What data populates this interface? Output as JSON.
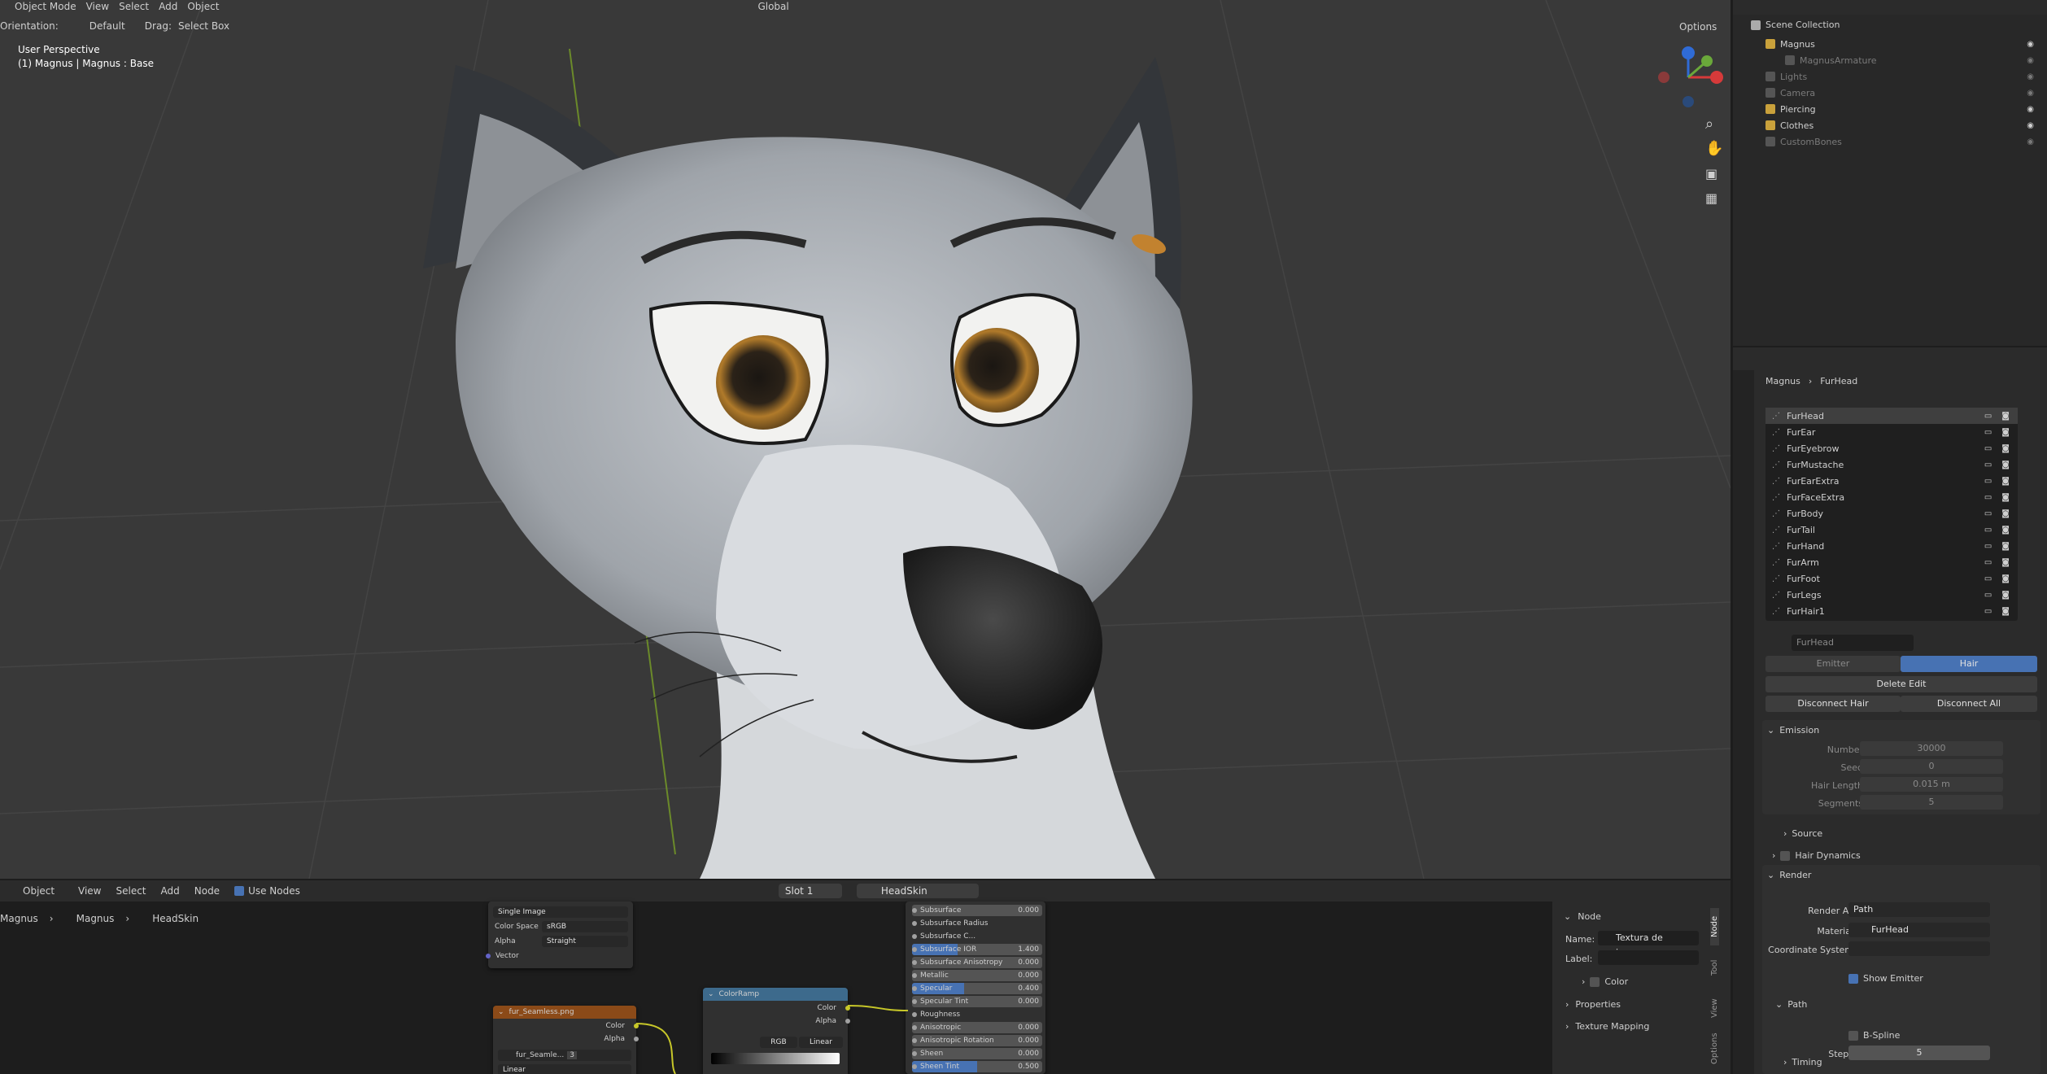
{
  "viewport": {
    "mode": "Object Mode",
    "menus": [
      "View",
      "Select",
      "Add",
      "Object"
    ],
    "orientation_label": "Orientation:",
    "orientation_value": "Default",
    "drag_label": "Drag:",
    "drag_value": "Select Box",
    "transform_space": "Global",
    "options": "Options",
    "overlay_line1": "User Perspective",
    "overlay_line2": "(1) Magnus | Magnus : Base"
  },
  "outliner": {
    "root": "Scene Collection",
    "items": [
      {
        "name": "Magnus",
        "dim": false
      },
      {
        "name": "MagnusArmature",
        "dim": true
      },
      {
        "name": "Lights",
        "dim": true
      },
      {
        "name": "Camera",
        "dim": true
      },
      {
        "name": "Piercing",
        "dim": false
      },
      {
        "name": "Clothes",
        "dim": false
      },
      {
        "name": "CustomBones",
        "dim": true
      }
    ]
  },
  "properties": {
    "breadcrumb_object": "Magnus",
    "breadcrumb_system": "FurHead",
    "systems": [
      "FurHead",
      "FurEar",
      "FurEyebrow",
      "FurMustache",
      "FurEarExtra",
      "FurFaceExtra",
      "FurBody",
      "FurTail",
      "FurHand",
      "FurArm",
      "FurFoot",
      "FurLegs",
      "FurHair1"
    ],
    "settings_name": "FurHead",
    "type_emitter": "Emitter",
    "type_hair": "Hair",
    "delete_edit": "Delete Edit",
    "disconnect_hair": "Disconnect Hair",
    "disconnect_all": "Disconnect All",
    "emission": {
      "title": "Emission",
      "number_label": "Number",
      "number": "30000",
      "seed_label": "Seed",
      "seed": "0",
      "hair_length_label": "Hair Length",
      "hair_length": "0.015 m",
      "segments_label": "Segments",
      "segments": "5"
    },
    "source": "Source",
    "hair_dynamics": "Hair Dynamics",
    "render": {
      "title": "Render",
      "render_as_label": "Render As",
      "render_as": "Path",
      "material_label": "Material",
      "material": "FurHead",
      "coord_label": "Coordinate System",
      "show_emitter": "Show Emitter",
      "path": "Path",
      "bspline": "B-Spline",
      "steps_label": "Steps",
      "steps": "5",
      "timing": "Timing"
    }
  },
  "node_editor": {
    "editor_type": "Object",
    "menus": [
      "View",
      "Select",
      "Add",
      "Node"
    ],
    "use_nodes": "Use Nodes",
    "slot": "Slot 1",
    "material": "HeadSkin",
    "breadcrumb": [
      "Magnus",
      "Magnus",
      "HeadSkin"
    ],
    "image_node": {
      "source": "Single Image",
      "colorspace_label": "Color Space",
      "colorspace": "sRGB",
      "alpha_label": "Alpha",
      "alpha": "Straight",
      "vector": "Vector"
    },
    "tex_node": {
      "title": "fur_Seamless.png",
      "color": "Color",
      "alpha": "Alpha",
      "image_name": "fur_Seamle...",
      "user_count": "3",
      "interp": "Linear"
    },
    "ramp_node": {
      "title": "ColorRamp",
      "color": "Color",
      "alpha": "Alpha",
      "mode": "RGB",
      "interp": "Linear"
    },
    "bsdf_rows": [
      {
        "label": "Subsurface",
        "value": "0.000",
        "fill": 0
      },
      {
        "label": "Subsurface Radius",
        "value": "",
        "fill": 0
      },
      {
        "label": "Subsurface C...",
        "value": "",
        "fill": 0
      },
      {
        "label": "Subsurface IOR",
        "value": "1.400",
        "fill": 0.35
      },
      {
        "label": "Subsurface Anisotropy",
        "value": "0.000",
        "fill": 0
      },
      {
        "label": "Metallic",
        "value": "0.000",
        "fill": 0
      },
      {
        "label": "Specular",
        "value": "0.400",
        "fill": 0.4
      },
      {
        "label": "Specular Tint",
        "value": "0.000",
        "fill": 0
      },
      {
        "label": "Roughness",
        "value": "",
        "fill": 0
      },
      {
        "label": "Anisotropic",
        "value": "0.000",
        "fill": 0
      },
      {
        "label": "Anisotropic Rotation",
        "value": "0.000",
        "fill": 0
      },
      {
        "label": "Sheen",
        "value": "0.000",
        "fill": 0
      },
      {
        "label": "Sheen Tint",
        "value": "0.500",
        "fill": 0.5
      }
    ],
    "sidebar": {
      "title": "Node",
      "name_label": "Name:",
      "name": "Textura de imagem",
      "label_label": "Label:",
      "color": "Color",
      "properties": "Properties",
      "texture_mapping": "Texture Mapping",
      "tabs": [
        "Node",
        "Tool",
        "View",
        "Options"
      ]
    }
  }
}
